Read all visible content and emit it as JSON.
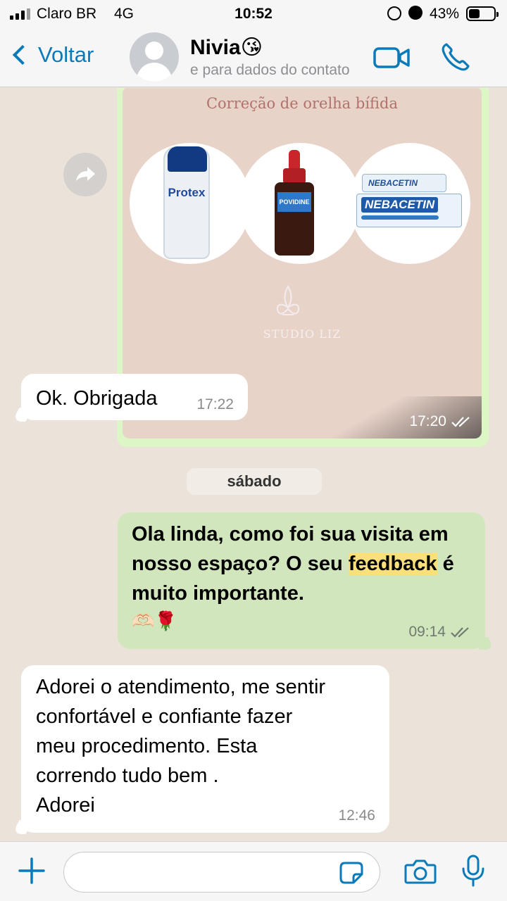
{
  "status_bar": {
    "carrier": "Claro BR",
    "network": "4G",
    "time": "10:52",
    "battery_percent": "43%",
    "battery_level": 0.43
  },
  "header": {
    "back_label": "Voltar",
    "contact_name": "Nivia😘",
    "contact_subtitle": "e para dados do contato"
  },
  "messages": {
    "image_message": {
      "title": "Correção de orelha bífida",
      "product_labels": [
        "Protex",
        "POVIDINE",
        "NEBACETIN",
        "NEBACETIN"
      ],
      "watermark": "STUDIO LIZ",
      "time": "17:20"
    },
    "incoming_1": {
      "text": "Ok. Obrigada",
      "time": "17:22"
    },
    "day_separator": "sábado",
    "outgoing_1": {
      "text_before": "Ola linda, como foi sua visita em nosso espaço? O seu ",
      "highlight": "feedback",
      "text_after": " é muito importante.",
      "emoji": "🫶🏻🌹",
      "time": "09:14"
    },
    "incoming_2": {
      "line1": "Adorei o atendimento, me sentir",
      "line2": "confortável e confiante  fazer",
      "line3": "meu procedimento. Esta",
      "line4": "correndo tudo bem .",
      "line5": "Adorei",
      "time": "12:46"
    }
  },
  "icons": {
    "accent_color": "#0a7ab8",
    "outgoing_bubble_color": "#d1e6bc",
    "incoming_bubble_color": "#ffffff"
  }
}
